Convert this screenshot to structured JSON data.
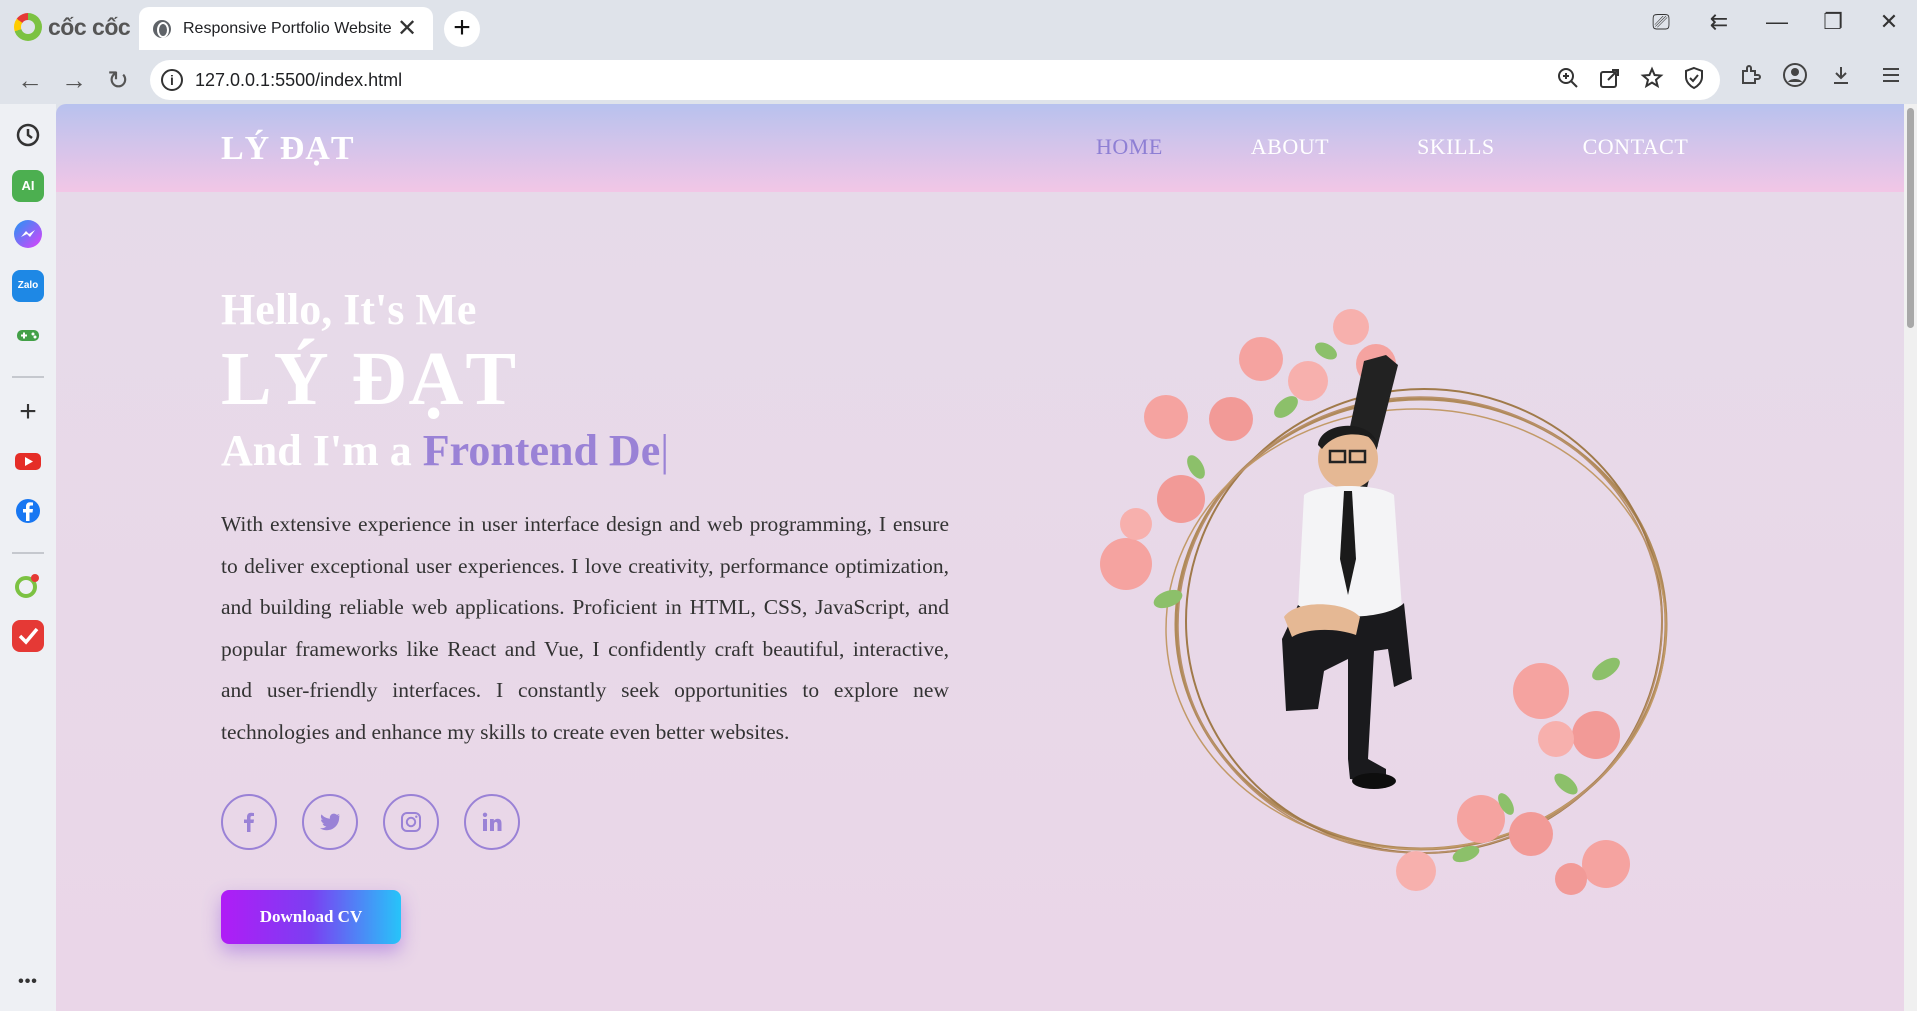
{
  "browser": {
    "brand_name": "cốc cốc",
    "tab_title": "Responsive Portfolio Website",
    "tab_close": "✕",
    "new_tab": "+",
    "url": "127.0.0.1:5500/index.html",
    "window_controls": {
      "screen_search": "⎚",
      "back_forward": "⇇",
      "minimize": "—",
      "restore": "❐",
      "close": "✕"
    },
    "nav": {
      "back": "←",
      "forward": "→",
      "reload": "↻"
    },
    "omnibox_icons": [
      "zoom-icon",
      "share-icon",
      "star-icon",
      "shield-icon"
    ],
    "toolbar_icons": [
      "extensions-icon",
      "profile-icon",
      "download-icon",
      "menu-icon"
    ],
    "sidebar": [
      {
        "name": "history-icon",
        "color": "#333333"
      },
      {
        "name": "ai-icon",
        "color": "#4caf50"
      },
      {
        "name": "messenger-icon",
        "color": "#7b61ff"
      },
      {
        "name": "zalo-icon",
        "color": "#1e88e5"
      },
      {
        "name": "game-icon",
        "color": "#43a047"
      },
      {
        "name": "add-icon",
        "color": "#333333"
      },
      {
        "name": "youtube-icon",
        "color": "#e52d27"
      },
      {
        "name": "facebook-icon",
        "color": "#1877f2"
      },
      {
        "name": "browser-game-icon",
        "color": "#7cc242"
      },
      {
        "name": "todo-icon",
        "color": "#e53935"
      }
    ],
    "sidebar_labels": {
      "ai": "AI",
      "zalo": "Zalo",
      "more": "•••"
    }
  },
  "site": {
    "logo": "LÝ ĐẠT",
    "nav": [
      {
        "label": "HOME",
        "active": true
      },
      {
        "label": "ABOUT",
        "active": false
      },
      {
        "label": "SKILLS",
        "active": false
      },
      {
        "label": "CONTACT",
        "active": false
      }
    ],
    "hero": {
      "greeting": "Hello, It's Me",
      "name": "LÝ ĐẠT",
      "role_prefix": "And I'm a ",
      "role_typed": "Frontend De",
      "caret": "|",
      "bio": "With extensive experience in user interface design and web programming, I ensure to deliver exceptional user experiences. I love creativity, performance optimization, and building reliable web applications. Proficient in HTML, CSS, JavaScript, and popular frameworks like React and Vue, I confidently craft beautiful, interactive, and user-friendly interfaces. I constantly seek opportunities to explore new technologies and enhance my skills to create even better websites."
    },
    "socials": [
      {
        "name": "facebook-icon",
        "glyph": "f"
      },
      {
        "name": "twitter-icon",
        "glyph": "t"
      },
      {
        "name": "instagram-icon",
        "glyph": "◎"
      },
      {
        "name": "linkedin-icon",
        "glyph": "in"
      }
    ],
    "cta_label": "Download CV",
    "colors": {
      "accent": "#9a82d6",
      "header_top": "#b8c2ee",
      "header_bottom": "#f2c6e6",
      "cta_start": "#b01cf6",
      "cta_end": "#27c4f9"
    }
  }
}
